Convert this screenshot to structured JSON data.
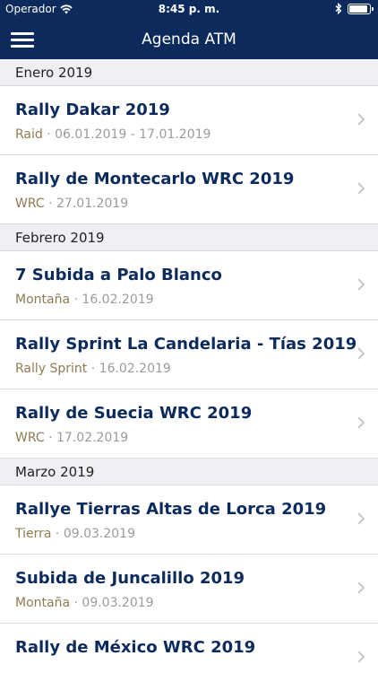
{
  "status": {
    "carrier": "Operador",
    "time": "8:45 p. m."
  },
  "header": {
    "title": "Agenda ATM"
  },
  "colors": {
    "brand": "#0c2b5c",
    "section_bg": "#efeff4",
    "type_text": "#8e7b52",
    "date_text": "#9b9b9b"
  },
  "sections": [
    {
      "label": "Enero 2019",
      "events": [
        {
          "name": "Rally Dakar 2019",
          "type": "Raid",
          "date": "06.01.2019 - 17.01.2019"
        },
        {
          "name": "Rally de Montecarlo WRC 2019",
          "type": "WRC",
          "date": "27.01.2019"
        }
      ]
    },
    {
      "label": "Febrero 2019",
      "events": [
        {
          "name": "7 Subida a Palo Blanco",
          "type": "Montaña",
          "date": "16.02.2019"
        },
        {
          "name": "Rally Sprint La Candelaria - Tías 2019",
          "type": "Rally Sprint",
          "date": "16.02.2019"
        },
        {
          "name": "Rally de Suecia WRC 2019",
          "type": "WRC",
          "date": "17.02.2019"
        }
      ]
    },
    {
      "label": "Marzo 2019",
      "events": [
        {
          "name": "Rallye Tierras Altas de Lorca 2019",
          "type": "Tierra",
          "date": "09.03.2019"
        },
        {
          "name": "Subida de Juncalillo 2019",
          "type": "Montaña",
          "date": "09.03.2019"
        },
        {
          "name": "Rally de México WRC 2019",
          "type": "",
          "date": ""
        }
      ]
    }
  ]
}
